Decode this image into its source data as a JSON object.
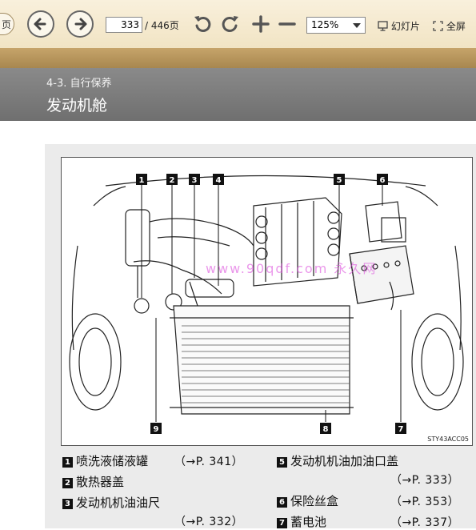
{
  "toolbar": {
    "prev_page_label": "页",
    "page_current": "333",
    "page_total": "/ 446页",
    "zoom": "125%",
    "slideshow_label": "幻灯片",
    "fullscreen_label": "全屏"
  },
  "section": {
    "number": "4-3. 自行保养",
    "title": "发动机舱"
  },
  "figure": {
    "code": "STY43ACC05",
    "watermark": "www.90qdf.com 永久网",
    "callouts": [
      "1",
      "2",
      "3",
      "4",
      "5",
      "6",
      "7",
      "8",
      "9"
    ]
  },
  "legend": [
    {
      "num": "1",
      "label": "喷洗液储液罐",
      "ref": "（→P.  341）"
    },
    {
      "num": "2",
      "label": "散热器盖",
      "ref": ""
    },
    {
      "num": "3",
      "label": "发动机机油油尺",
      "ref": "（→P.  332）"
    },
    {
      "num": "5",
      "label": "发动机机油加油口盖",
      "ref": "（→P.  333）"
    },
    {
      "num": "6",
      "label": "保险丝盒",
      "ref": "（→P.  353）"
    },
    {
      "num": "7",
      "label": "蓄电池",
      "ref": "（→P.  337）"
    }
  ]
}
